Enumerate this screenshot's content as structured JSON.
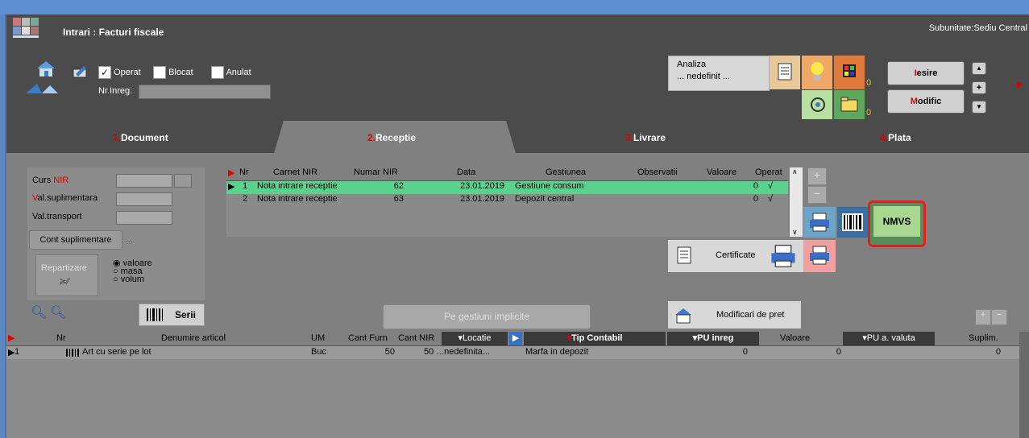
{
  "window": {
    "title": "Intrari : Facturi fiscale",
    "subunitate": "Subunitate:Sediu Central"
  },
  "header": {
    "chk_operat": "Operat",
    "chk_blocat": "Blocat",
    "chk_anulat": "Anulat",
    "nr_inreg_label": "Nr.Inreg:",
    "analiza_label": "Analiza",
    "analiza_value": "... nedefinit ...",
    "counter1": "0",
    "counter2": "0",
    "iesire_hot": "I",
    "iesire_rest": "esire",
    "modific_hot": "M",
    "modific_rest": "odific",
    "plus": "+"
  },
  "tabs": [
    {
      "num": "1.",
      "label": "Document"
    },
    {
      "num": "2.",
      "label": "Receptie"
    },
    {
      "num": "3.",
      "label": "Livrare"
    },
    {
      "num": "4.",
      "label": "Plata"
    }
  ],
  "leftpanel": {
    "curs_pre": "Curs ",
    "curs_hot": "NIR",
    "val_sup_hot": "V",
    "val_sup_rest": "al.suplimentara",
    "val_transport": "Val.transport",
    "cont_sup": "Cont suplimentare",
    "dots": "...",
    "repartizare": "Repartizare",
    "opt_valoare": "valoare",
    "opt_masa": "masa",
    "opt_volum": "volum"
  },
  "nir_grid": {
    "headers": [
      "Nr",
      "Carnet NIR",
      "Numar NIR",
      "Data",
      "Gestiunea",
      "Observatii",
      "Valoare",
      "Operat"
    ],
    "rows": [
      {
        "nr": "1",
        "carnet": "Nota intrare receptie",
        "numar": "62",
        "data": "23.01.2019",
        "gestiune": "Gestiune consum",
        "valoare": "0",
        "operat": "√"
      },
      {
        "nr": "2",
        "carnet": "Nota intrare receptie",
        "numar": "63",
        "data": "23.01.2019",
        "gestiune": "Depozit central",
        "valoare": "0",
        "operat": "√"
      }
    ]
  },
  "buttons": {
    "nmvs": "NMVS",
    "certificate": "Certificate",
    "serii": "Serii",
    "pe_gestiuni": "Pe gestiuni implicite",
    "modificari_pret": "Modificari de pret"
  },
  "articles": {
    "headers": [
      "Nr",
      "Denumire articol",
      "UM",
      "Cant Furn",
      "Cant NIR",
      "Locatie",
      "Tip Contabil",
      "PU inreg",
      "Valoare.",
      "PU a. valuta",
      "Suplim."
    ],
    "rows": [
      {
        "nr": "1",
        "denumire": "Art cu serie pe lot",
        "um": "Buc",
        "cant_furn": "50",
        "cant_nir": "50",
        "locatie": "...nedefinita...",
        "tip": "Marfa in depozit",
        "pu": "0",
        "valoare": "0",
        "suplim": "0"
      }
    ]
  },
  "colors": {
    "accent_red": "#e00000",
    "selected_row": "#5bd18e",
    "nmvs_bg": "#a8d890"
  }
}
